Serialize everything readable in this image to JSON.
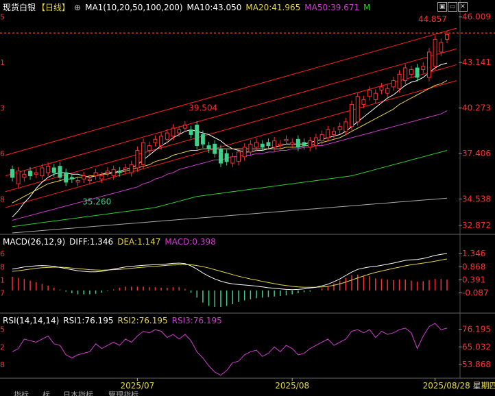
{
  "header": {
    "title": "现货白银",
    "period": "【日线】",
    "ma_name": "MA1(10,20,50,100,200)",
    "ma10": "MA10:43.050",
    "ma20": "MA20:41.965",
    "ma50": "MA50:39.671",
    "more": "M",
    "symbols": {
      "settings": "⊕",
      "expand": "▣",
      "collapse": "▭",
      "close": "✕"
    }
  },
  "macd_header": {
    "name": "MACD(26,12,9)",
    "diff": "DIFF:1.346",
    "dea": "DEA:1.147",
    "macd": "MACD:0.398"
  },
  "rsi_header": {
    "name": "RSI(14,14,14)",
    "rsi1": "RSI1:76.195",
    "rsi2": "RSI2:76.195",
    "rsi3": "RSI3:76.195"
  },
  "colors": {
    "up": "#ff3030",
    "down": "#3fd08a",
    "ma10": "#ffffff",
    "ma20": "#e8d64a",
    "ma50": "#d23bd2",
    "ma100": "#2fd02f",
    "ma200": "#aaaaaa",
    "channel": "#ff2020",
    "rsi": "#d23bd2",
    "dea": "#e8d64a",
    "diff": "#ffffff",
    "price_text": "#ff3030"
  },
  "chart_data": [
    {
      "type": "candlestick",
      "title": "现货白银 日线",
      "y_ticks": [
        "46.009",
        "43.141",
        "40.273",
        "37.406",
        "34.538",
        "32.872"
      ],
      "y_tick_values": [
        46.009,
        43.141,
        40.273,
        37.406,
        34.538,
        32.872
      ],
      "left_ticks": [
        "5",
        "1",
        "3",
        "6",
        "8"
      ],
      "ylim": [
        32.4,
        46.3
      ],
      "annotations": {
        "high": "44.857",
        "mid_high": "39.504",
        "low": "35.260"
      },
      "last_price_line": 45.0,
      "x_labels": [
        "2025/07",
        "2025/08",
        "2025/08/28 星期四"
      ],
      "x_label_index": [
        21,
        47,
        71
      ],
      "x_start_value": 36.4,
      "closes": [
        35.9,
        36.3,
        36.1,
        36.0,
        36.2,
        36.5,
        36.6,
        36.2,
        35.9,
        35.6,
        35.8,
        35.7,
        36.0,
        35.8,
        36.2,
        36.0,
        36.3,
        36.4,
        36.2,
        36.5,
        36.7,
        37.6,
        38.1,
        37.9,
        38.3,
        38.5,
        38.7,
        39.0,
        38.9,
        39.2,
        38.6,
        37.9,
        38.0,
        37.7,
        37.4,
        36.8,
        36.9,
        37.2,
        37.5,
        37.8,
        38.0,
        38.1,
        37.8,
        37.9,
        38.2,
        38.0,
        38.3,
        38.1,
        37.8,
        37.9,
        38.2,
        38.4,
        38.6,
        38.9,
        38.8,
        39.1,
        39.4,
        40.5,
        41.0,
        40.8,
        41.4,
        41.2,
        41.6,
        41.5,
        42.0,
        42.4,
        42.8,
        42.7,
        42.2,
        42.9,
        43.8,
        44.6,
        44.4,
        44.9
      ],
      "opens": [
        35.5,
        35.9,
        36.3,
        36.1,
        36.0,
        36.2,
        36.5,
        36.6,
        36.2,
        35.9,
        35.6,
        35.8,
        35.7,
        36.0,
        35.8,
        36.2,
        36.0,
        36.3,
        36.4,
        36.2,
        36.5,
        36.7,
        37.6,
        38.1,
        37.9,
        38.3,
        38.5,
        38.7,
        39.0,
        38.9,
        39.2,
        38.6,
        37.9,
        38.0,
        37.7,
        37.4,
        36.8,
        36.9,
        37.2,
        37.5,
        37.8,
        38.0,
        38.1,
        37.8,
        37.9,
        38.2,
        38.0,
        38.3,
        38.1,
        37.8,
        37.9,
        38.2,
        38.4,
        38.6,
        38.9,
        38.8,
        39.1,
        39.4,
        40.5,
        41.0,
        40.8,
        41.4,
        41.2,
        41.6,
        41.5,
        42.0,
        42.4,
        42.8,
        42.7,
        42.2,
        42.9,
        43.8,
        44.6,
        44.4
      ],
      "ma": [
        {
          "name": "MA10",
          "color_key": "ma10",
          "values_start": 33.4,
          "values": [
            33.4,
            33.8,
            34.3,
            34.7,
            35.2,
            35.6,
            35.9,
            36.1,
            36.2,
            36.2,
            36.1,
            36.1,
            36.0,
            35.9,
            36.0,
            36.1,
            36.2,
            36.2,
            36.3,
            36.4,
            36.5,
            36.7,
            37.0,
            37.3,
            37.6,
            37.9,
            38.1,
            38.4,
            38.6,
            38.8,
            38.9,
            38.8,
            38.7,
            38.6,
            38.4,
            38.2,
            37.9,
            37.7,
            37.6,
            37.5,
            37.5,
            37.6,
            37.6,
            37.7,
            37.8,
            37.9,
            38.0,
            38.0,
            38.0,
            38.0,
            38.1,
            38.2,
            38.3,
            38.4,
            38.5,
            38.6,
            38.8,
            39.1,
            39.4,
            39.7,
            40.0,
            40.3,
            40.6,
            40.9,
            41.1,
            41.4,
            41.7,
            41.9,
            42.0,
            42.2,
            42.5,
            42.8,
            43.0,
            43.1
          ]
        },
        {
          "name": "MA20",
          "color_key": "ma20",
          "values": [
            34.3,
            34.5,
            34.7,
            34.9,
            35.1,
            35.3,
            35.5,
            35.6,
            35.7,
            35.8,
            35.8,
            35.9,
            35.9,
            36.0,
            36.0,
            36.1,
            36.1,
            36.2,
            36.2,
            36.3,
            36.4,
            36.5,
            36.6,
            36.7,
            36.9,
            37.0,
            37.1,
            37.3,
            37.4,
            37.5,
            37.6,
            37.6,
            37.7,
            37.7,
            37.7,
            37.7,
            37.7,
            37.7,
            37.7,
            37.7,
            37.7,
            37.7,
            37.7,
            37.7,
            37.7,
            37.7,
            37.8,
            37.8,
            37.8,
            37.9,
            37.9,
            38.0,
            38.1,
            38.2,
            38.3,
            38.4,
            38.6,
            38.8,
            39.0,
            39.2,
            39.4,
            39.6,
            39.8,
            40.0,
            40.2,
            40.5,
            40.7,
            40.9,
            41.1,
            41.3,
            41.5,
            41.7,
            41.8,
            42.0
          ]
        },
        {
          "name": "MA50",
          "color_key": "ma50",
          "values": [
            33.2,
            33.3,
            33.4,
            33.5,
            33.6,
            33.7,
            33.8,
            33.9,
            34.0,
            34.1,
            34.2,
            34.3,
            34.4,
            34.5,
            34.6,
            34.7,
            34.8,
            34.9,
            35.0,
            35.1,
            35.2,
            35.3,
            35.5,
            35.6,
            35.8,
            35.9,
            36.1,
            36.2,
            36.4,
            36.5,
            36.6,
            36.7,
            36.8,
            36.9,
            37.0,
            37.0,
            37.1,
            37.2,
            37.2,
            37.3,
            37.3,
            37.4,
            37.4,
            37.5,
            37.5,
            37.6,
            37.6,
            37.7,
            37.7,
            37.8,
            37.8,
            37.9,
            37.9,
            38.0,
            38.1,
            38.2,
            38.3,
            38.4,
            38.5,
            38.6,
            38.7,
            38.8,
            38.9,
            39.0,
            39.1,
            39.2,
            39.3,
            39.4,
            39.5,
            39.6,
            39.7,
            39.8,
            39.9,
            40.1
          ]
        },
        {
          "name": "MA100",
          "color_key": "ma100",
          "values": [
            32.8,
            32.85,
            32.9,
            32.95,
            33.0,
            33.05,
            33.1,
            33.15,
            33.2,
            33.25,
            33.3,
            33.35,
            33.4,
            33.45,
            33.5,
            33.55,
            33.6,
            33.65,
            33.7,
            33.75,
            33.8,
            33.85,
            33.9,
            33.95,
            34.0,
            34.1,
            34.2,
            34.3,
            34.4,
            34.5,
            34.6,
            34.7,
            34.75,
            34.8,
            34.85,
            34.9,
            34.95,
            35.0,
            35.05,
            35.1,
            35.15,
            35.2,
            35.25,
            35.3,
            35.35,
            35.4,
            35.45,
            35.5,
            35.55,
            35.6,
            35.65,
            35.7,
            35.75,
            35.8,
            35.85,
            35.9,
            35.95,
            36.0,
            36.1,
            36.2,
            36.3,
            36.4,
            36.5,
            36.6,
            36.7,
            36.8,
            36.9,
            37.0,
            37.1,
            37.2,
            37.3,
            37.4,
            37.5,
            37.6
          ]
        },
        {
          "name": "MA200",
          "color_key": "ma200",
          "values": [
            32.4,
            32.43,
            32.46,
            32.49,
            32.52,
            32.55,
            32.58,
            32.61,
            32.64,
            32.67,
            32.7,
            32.73,
            32.76,
            32.79,
            32.82,
            32.85,
            32.88,
            32.91,
            32.94,
            32.97,
            33.0,
            33.03,
            33.06,
            33.09,
            33.12,
            33.15,
            33.18,
            33.21,
            33.24,
            33.27,
            33.3,
            33.33,
            33.36,
            33.39,
            33.42,
            33.45,
            33.48,
            33.51,
            33.54,
            33.57,
            33.6,
            33.63,
            33.66,
            33.69,
            33.72,
            33.75,
            33.78,
            33.81,
            33.84,
            33.87,
            33.9,
            33.93,
            33.96,
            33.99,
            34.02,
            34.05,
            34.08,
            34.11,
            34.14,
            34.17,
            34.2,
            34.23,
            34.26,
            34.29,
            34.32,
            34.35,
            34.38,
            34.41,
            34.44,
            34.47,
            34.5,
            34.53,
            34.56,
            34.59
          ]
        }
      ],
      "channels": [
        {
          "from": 37.3,
          "to": 45.3
        },
        {
          "from": 36.0,
          "to": 44.0
        },
        {
          "from": 35.0,
          "to": 43.0
        },
        {
          "from": 34.0,
          "to": 42.0
        }
      ]
    },
    {
      "type": "macd",
      "y_ticks": [
        "1.346",
        "0.868",
        "0.391",
        "-0.087"
      ],
      "y_tick_values": [
        1.346,
        0.868,
        0.391,
        -0.087
      ],
      "ylim": [
        -0.45,
        1.6
      ],
      "left_ticks": [
        "6",
        "8",
        "1",
        "7"
      ],
      "diff": [
        0.78,
        0.82,
        0.86,
        0.88,
        0.9,
        0.91,
        0.9,
        0.88,
        0.84,
        0.8,
        0.76,
        0.72,
        0.7,
        0.68,
        0.68,
        0.7,
        0.74,
        0.78,
        0.82,
        0.86,
        0.88,
        0.9,
        0.92,
        0.93,
        0.94,
        0.95,
        0.97,
        0.99,
        1.0,
        0.98,
        0.9,
        0.78,
        0.64,
        0.52,
        0.42,
        0.34,
        0.28,
        0.24,
        0.22,
        0.2,
        0.18,
        0.16,
        0.13,
        0.1,
        0.08,
        0.06,
        0.04,
        0.03,
        0.04,
        0.06,
        0.09,
        0.12,
        0.17,
        0.23,
        0.32,
        0.42,
        0.55,
        0.67,
        0.77,
        0.82,
        0.86,
        0.88,
        0.92,
        0.96,
        1.0,
        1.05,
        1.1,
        1.12,
        1.13,
        1.17,
        1.22,
        1.28,
        1.32,
        1.35
      ],
      "dea": [
        0.7,
        0.72,
        0.75,
        0.78,
        0.81,
        0.83,
        0.84,
        0.85,
        0.85,
        0.84,
        0.82,
        0.8,
        0.78,
        0.76,
        0.75,
        0.74,
        0.75,
        0.76,
        0.77,
        0.79,
        0.81,
        0.83,
        0.85,
        0.87,
        0.88,
        0.9,
        0.92,
        0.93,
        0.94,
        0.95,
        0.94,
        0.91,
        0.87,
        0.82,
        0.76,
        0.7,
        0.64,
        0.58,
        0.52,
        0.47,
        0.42,
        0.38,
        0.33,
        0.29,
        0.25,
        0.21,
        0.18,
        0.15,
        0.13,
        0.12,
        0.12,
        0.12,
        0.13,
        0.15,
        0.19,
        0.24,
        0.31,
        0.38,
        0.46,
        0.53,
        0.6,
        0.66,
        0.71,
        0.76,
        0.81,
        0.85,
        0.9,
        0.94,
        0.97,
        1.0,
        1.03,
        1.07,
        1.11,
        1.15
      ],
      "hist": [
        0.5,
        0.46,
        0.42,
        0.36,
        0.3,
        0.24,
        0.18,
        0.1,
        0.04,
        -0.04,
        -0.1,
        -0.14,
        -0.14,
        -0.14,
        -0.12,
        -0.08,
        -0.02,
        0.04,
        0.1,
        0.14,
        0.14,
        0.14,
        0.14,
        0.12,
        0.12,
        0.1,
        0.1,
        0.12,
        0.12,
        0.06,
        -0.08,
        -0.26,
        -0.44,
        -0.56,
        -0.6,
        -0.6,
        -0.56,
        -0.5,
        -0.42,
        -0.36,
        -0.32,
        -0.28,
        -0.26,
        -0.24,
        -0.22,
        -0.2,
        -0.18,
        -0.14,
        -0.1,
        -0.06,
        -0.04,
        0.0,
        0.08,
        0.16,
        0.26,
        0.36,
        0.46,
        0.56,
        0.58,
        0.54,
        0.52,
        0.44,
        0.42,
        0.4,
        0.38,
        0.4,
        0.4,
        0.36,
        0.32,
        0.34,
        0.38,
        0.42,
        0.42,
        0.4
      ]
    },
    {
      "type": "line",
      "name": "RSI",
      "y_ticks": [
        "76.195",
        "65.032",
        "53.868"
      ],
      "y_tick_values": [
        76.195,
        65.032,
        53.868
      ],
      "ylim": [
        46,
        80
      ],
      "left_ticks": [
        "5",
        "2",
        "8"
      ],
      "values": [
        62,
        64,
        70,
        69,
        68,
        70,
        72,
        67,
        66,
        60,
        58,
        60,
        61,
        62,
        67,
        64,
        66,
        68,
        66,
        70,
        68,
        72,
        75,
        74,
        76,
        75,
        71,
        73,
        70,
        73,
        69,
        62,
        58,
        53,
        49,
        47,
        50,
        55,
        56,
        60,
        62,
        63,
        59,
        61,
        65,
        62,
        66,
        64,
        60,
        61,
        64,
        66,
        68,
        70,
        66,
        68,
        70,
        75,
        76,
        74,
        76,
        71,
        75,
        73,
        74,
        76,
        77,
        74,
        64,
        72,
        78,
        80,
        76,
        77
      ]
    }
  ],
  "bottom_tabs": [
    "指标",
    "标",
    "日本指标",
    "管理指标"
  ]
}
